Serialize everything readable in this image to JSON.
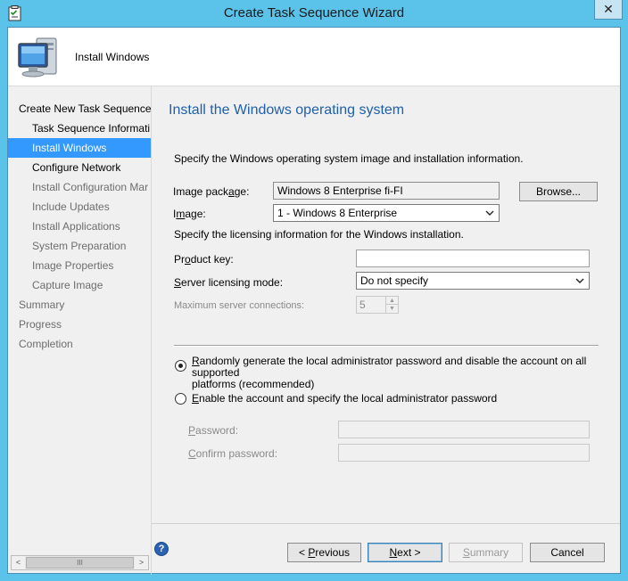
{
  "window": {
    "title": "Create Task Sequence Wizard",
    "close_glyph": "✕"
  },
  "header": {
    "title": "Install Windows"
  },
  "nav": {
    "items": [
      {
        "label": "Create New Task Sequence",
        "level": 0,
        "state": "normal"
      },
      {
        "label": "Task Sequence Informati",
        "level": 1,
        "state": "normal"
      },
      {
        "label": "Install Windows",
        "level": 1,
        "state": "selected"
      },
      {
        "label": "Configure Network",
        "level": 1,
        "state": "normal"
      },
      {
        "label": "Install Configuration Mar",
        "level": 1,
        "state": "disabled"
      },
      {
        "label": "Include Updates",
        "level": 1,
        "state": "disabled"
      },
      {
        "label": "Install Applications",
        "level": 1,
        "state": "disabled"
      },
      {
        "label": "System Preparation",
        "level": 1,
        "state": "disabled"
      },
      {
        "label": "Image Properties",
        "level": 1,
        "state": "disabled"
      },
      {
        "label": "Capture Image",
        "level": 1,
        "state": "disabled"
      },
      {
        "label": "Summary",
        "level": 0,
        "state": "disabled"
      },
      {
        "label": "Progress",
        "level": 0,
        "state": "disabled"
      },
      {
        "label": "Completion",
        "level": 0,
        "state": "disabled"
      }
    ],
    "scroll": {
      "left": "<",
      "right": ">",
      "thumb": "III"
    }
  },
  "main": {
    "title": "Install the Windows operating system",
    "description": "Specify the Windows operating system image and installation information.",
    "image_package": {
      "label_pre": "Image pack",
      "label_key": "a",
      "label_post": "ge:",
      "value": "Windows 8 Enterprise  fi-FI",
      "browse": "Browse..."
    },
    "image": {
      "label_pre": "I",
      "label_key": "m",
      "label_post": "age:",
      "value": "1 - Windows 8 Enterprise"
    },
    "licensing_desc": "Specify the licensing information for the Windows installation.",
    "product_key": {
      "label_pre": "Pr",
      "label_key": "o",
      "label_post": "duct key:",
      "value": ""
    },
    "server_licensing": {
      "label_pre": "",
      "label_key": "S",
      "label_post": "erver licensing mode:",
      "value": "Do not specify"
    },
    "max_connections": {
      "label": "Maximum server connections:",
      "value": "5"
    },
    "radio_random": {
      "key": "R",
      "label_rest": "andomly generate the local administrator password and disable the account on all supported",
      "label_line2": "platforms (recommended)",
      "checked": true
    },
    "radio_enable": {
      "key": "E",
      "label_rest": "nable the account and specify the local administrator password",
      "checked": false
    },
    "password": {
      "label_pre": "",
      "label_key": "P",
      "label_post": "assword:",
      "value": ""
    },
    "confirm_password": {
      "label_pre": "",
      "label_key": "C",
      "label_post": "onfirm password:",
      "value": ""
    }
  },
  "footer": {
    "help_glyph": "?",
    "previous": {
      "pre": "< ",
      "key": "P",
      "post": "revious"
    },
    "next": {
      "pre": "",
      "key": "N",
      "post": "ext >"
    },
    "summary": {
      "pre": "",
      "key": "S",
      "post": "ummary"
    },
    "cancel": "Cancel"
  }
}
